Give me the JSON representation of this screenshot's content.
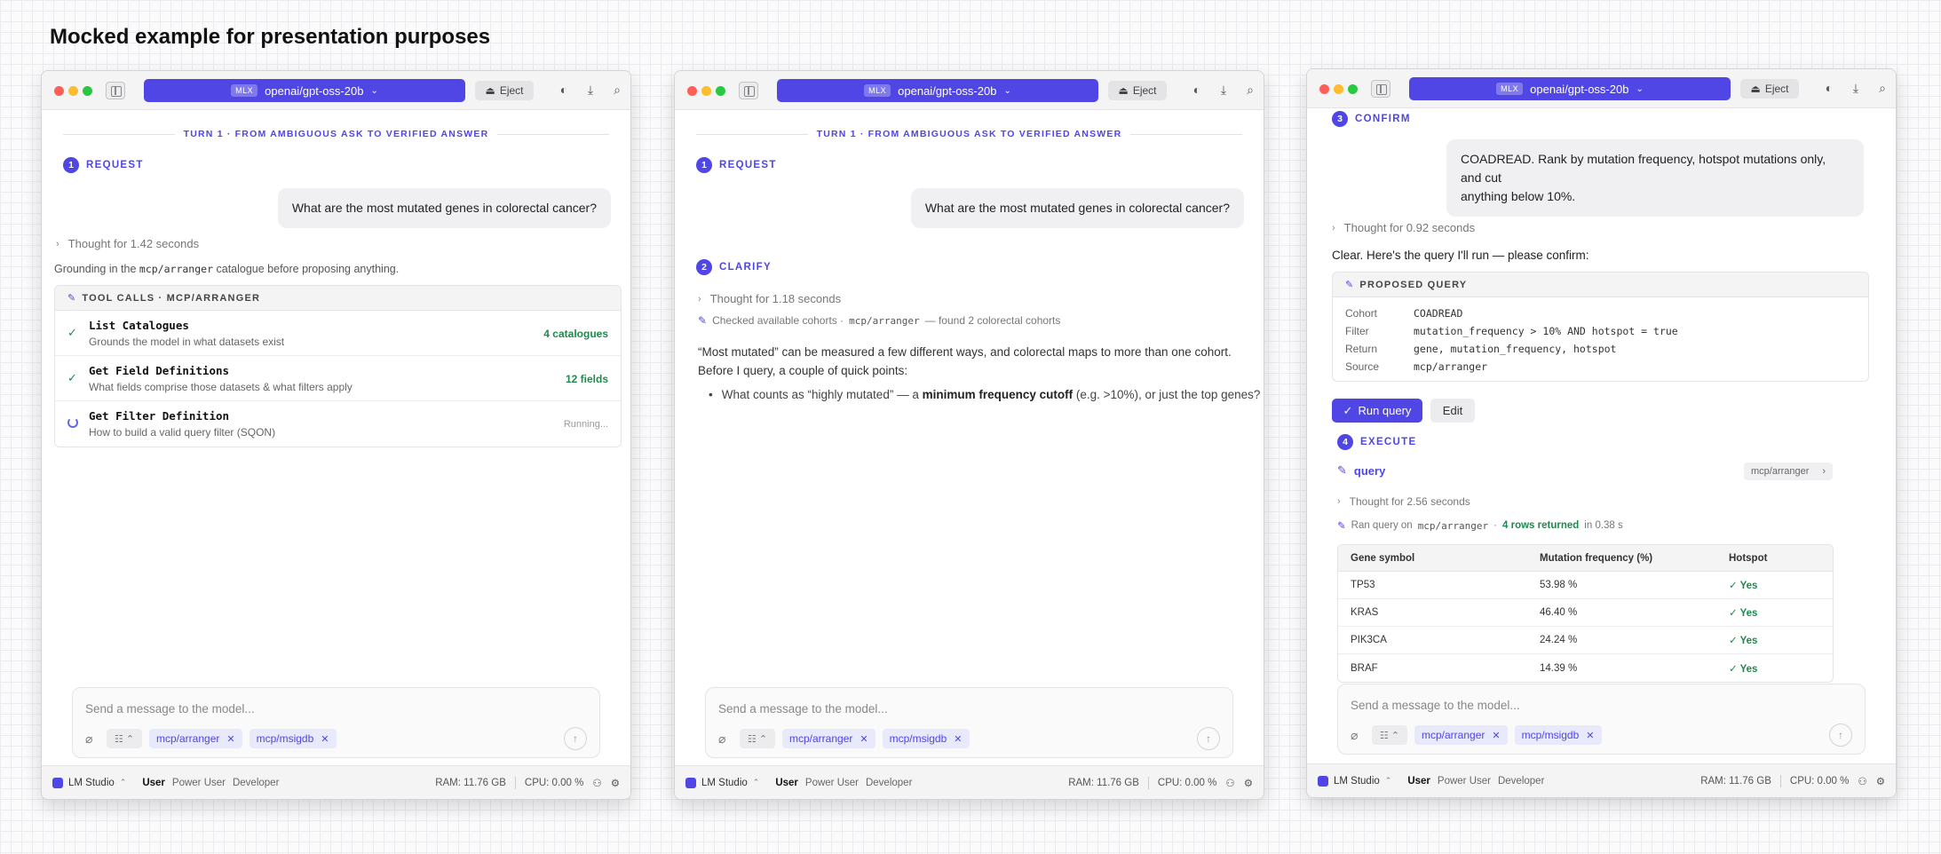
{
  "page_title": "Mocked example for presentation purposes",
  "app": {
    "model_badge": "MLX",
    "model_name": "openai/gpt-oss-20b",
    "eject": "Eject",
    "icons": [
      "palette-icon",
      "download-icon",
      "search-icon"
    ]
  },
  "composer": {
    "placeholder": "Send a message to the model...",
    "chips": [
      "mcp/arranger",
      "mcp/msigdb"
    ]
  },
  "status": {
    "app_name": "LM Studio",
    "modes": [
      "User",
      "Power User",
      "Developer"
    ],
    "active_mode": "User",
    "ram": "RAM: 11.76 GB",
    "cpu": "CPU: 0.00 %"
  },
  "turn_label": "TURN 1 · FROM AMBIGUOUS ASK TO VERIFIED ANSWER",
  "w1": {
    "step1": {
      "num": "1",
      "label": "REQUEST"
    },
    "question": "What are the most mutated genes in colorectal cancer?",
    "thought": "Thought for 1.42 seconds",
    "grounding": {
      "pre": "Grounding in the",
      "code": "mcp/arranger",
      "post": "catalogue before proposing anything."
    },
    "tools_header": "TOOL CALLS · MCP/ARRANGER",
    "tools": [
      {
        "name": "List Catalogues",
        "desc": "Grounds the model in what datasets exist",
        "result": "4 catalogues"
      },
      {
        "name": "Get Field Definitions",
        "desc": "What fields comprise those datasets & what filters apply",
        "result": "12 fields"
      },
      {
        "name": "Get Filter Definition",
        "desc": "How to build a valid query filter (SQON)",
        "result": "Running..."
      }
    ]
  },
  "w2": {
    "step1": {
      "num": "1",
      "label": "REQUEST"
    },
    "question": "What are the most mutated genes in colorectal cancer?",
    "step2": {
      "num": "2",
      "label": "CLARIFY"
    },
    "thought": "Thought for 1.18 seconds",
    "checked": {
      "pre": "Checked available cohorts ·",
      "code": "mcp/arranger",
      "post": "— found 2 colorectal cohorts"
    },
    "para1": "“Most mutated” can be measured a few different ways, and colorectal maps to more than one cohort.",
    "para2": "Before I query, a couple of quick points:",
    "bullet": {
      "pre": "What counts as “highly mutated” — a",
      "bold": "minimum frequency cutoff",
      "post": "(e.g. >10%), or just the top genes?"
    }
  },
  "w3": {
    "step3": {
      "num": "3",
      "label": "CONFIRM"
    },
    "answer_line1": "COADREAD. Rank by mutation frequency, hotspot mutations only, and cut",
    "answer_line2": "anything below 10%.",
    "thought1": "Thought for 0.92 seconds",
    "intro": "Clear. Here's the query I'll run — please confirm:",
    "pq_header": "PROPOSED QUERY",
    "pq_rows": [
      {
        "k": "Cohort",
        "v": "COADREAD"
      },
      {
        "k": "Filter",
        "v": "mutation_frequency > 10% AND hotspot = true"
      },
      {
        "k": "Return",
        "v": "gene, mutation_frequency, hotspot"
      },
      {
        "k": "Source",
        "v": "mcp/arranger"
      }
    ],
    "run_label": "Run query",
    "edit_label": "Edit",
    "step4": {
      "num": "4",
      "label": "EXECUTE"
    },
    "query_label": "query",
    "query_tag": "mcp/arranger",
    "thought2": "Thought for 2.56 seconds",
    "ran": {
      "pre": "Ran query on",
      "code": "mcp/arranger",
      "sep": "·",
      "rows": "4 rows returned",
      "time": "in 0.38 s"
    },
    "table": {
      "headers": [
        "Gene symbol",
        "Mutation frequency (%)",
        "Hotspot"
      ],
      "rows": [
        [
          "TP53",
          "53.98 %",
          "Yes"
        ],
        [
          "KRAS",
          "46.40 %",
          "Yes"
        ],
        [
          "PIK3CA",
          "24.24 %",
          "Yes"
        ],
        [
          "BRAF",
          "14.39 %",
          "Yes"
        ]
      ]
    }
  }
}
